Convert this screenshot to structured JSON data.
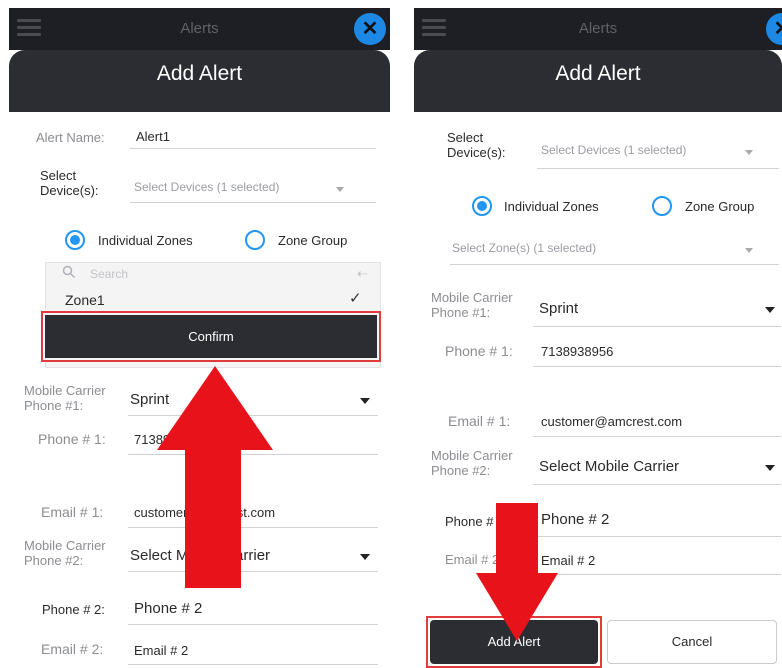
{
  "left": {
    "topbar_title": "Alerts",
    "header_title": "Add Alert",
    "alert_name_label": "Alert Name:",
    "alert_name_value": "Alert1",
    "select_devices_label_l1": "Select",
    "select_devices_label_l2": "Device(s):",
    "select_devices_value": "Select Devices (1 selected)",
    "radio_individual": "Individual Zones",
    "radio_group": "Zone Group",
    "search_placeholder": "Search",
    "zone_item": "Zone1",
    "confirm_label": "Confirm",
    "carrier1_label_l1": "Mobile Carrier",
    "carrier1_label_l2": "Phone #1:",
    "carrier1_value": "Sprint",
    "phone1_label": "Phone # 1:",
    "phone1_value": "7138938956",
    "email1_label": "Email # 1:",
    "email1_value": "customer@amcrest.com",
    "carrier2_label_l1": "Mobile Carrier",
    "carrier2_label_l2": "Phone #2:",
    "carrier2_value": "Select Mobile Carrier",
    "phone2_label": "Phone # 2:",
    "phone2_value": "Phone # 2",
    "email2_label": "Email # 2:",
    "email2_value": "Email # 2"
  },
  "right": {
    "topbar_title": "Alerts",
    "header_title": "Add Alert",
    "select_devices_label_l1": "Select",
    "select_devices_label_l2": "Device(s):",
    "select_devices_value": "Select Devices (1 selected)",
    "radio_individual": "Individual Zones",
    "radio_group": "Zone Group",
    "select_zones_value": "Select Zone(s) (1 selected)",
    "carrier1_label_l1": "Mobile Carrier",
    "carrier1_label_l2": "Phone #1:",
    "carrier1_value": "Sprint",
    "phone1_label": "Phone # 1:",
    "phone1_value": "7138938956",
    "email1_label": "Email # 1:",
    "email1_value": "customer@amcrest.com",
    "carrier2_label_l1": "Mobile Carrier",
    "carrier2_label_l2": "Phone #2:",
    "carrier2_value": "Select Mobile Carrier",
    "phone2_label": "Phone # 2",
    "phone2_value": "Phone # 2",
    "email2_label": "Email # 2",
    "email2_value": "Email # 2",
    "add_alert_label": "Add Alert",
    "cancel_label": "Cancel"
  },
  "colors": {
    "annotation_red": "#e8121b",
    "accent_blue": "#2196f3",
    "dark_bar": "#2b2d33"
  },
  "icons": [
    "menu-icon",
    "close-icon",
    "search-icon",
    "checkmark-icon",
    "chevron-down-icon",
    "back-arrow-icon",
    "up-arrow-annotation",
    "down-arrow-annotation"
  ]
}
